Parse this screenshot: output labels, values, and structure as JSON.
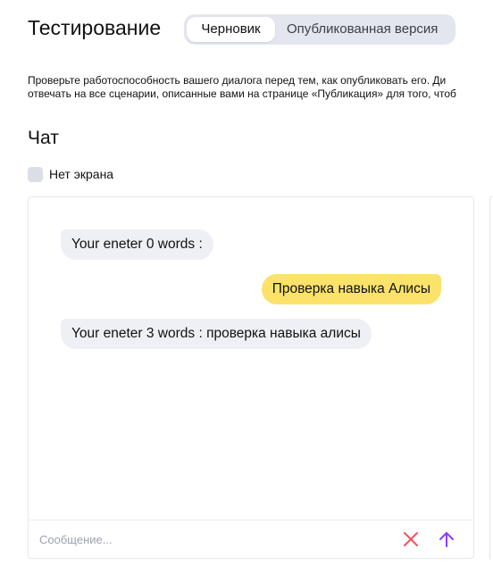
{
  "page": {
    "title": "Тестирование"
  },
  "mode_switch": {
    "options": [
      {
        "label": "Черновик",
        "selected": true
      },
      {
        "label": "Опубликованная версия",
        "selected": false
      }
    ]
  },
  "description": {
    "line1": "Проверьте работоспособность вашего диалога перед тем, как опубликовать его. Ди",
    "line2": "отвечать на все сценарии, описанные вами на странице «Публикация» для того, чтоб"
  },
  "chat_section": {
    "title": "Чат",
    "no_screen_checkbox": {
      "label": "Нет экрана",
      "checked": false
    }
  },
  "chat": {
    "messages": [
      {
        "from": "bot",
        "text": "Your eneter 0 words :"
      },
      {
        "from": "user",
        "text": "Проверка навыка Алисы"
      },
      {
        "from": "bot",
        "text": "Your eneter 3 words : проверка навыка алисы"
      }
    ],
    "composer": {
      "value": "",
      "placeholder": "Сообщение..."
    },
    "clear_icon": "close-icon",
    "send_icon": "arrow-up-icon"
  },
  "colors": {
    "user_bubble": "#fbe26b",
    "bot_bubble": "#eef0f5",
    "clear_icon": "#f0555f",
    "send_icon": "#8a3ffc",
    "switch_bg": "#e3e5ef"
  }
}
